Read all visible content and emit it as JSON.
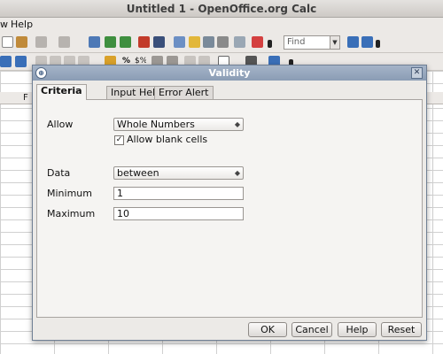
{
  "window": {
    "title": "Untitled 1 - OpenOffice.org Calc"
  },
  "menu": {
    "view_fragment": "w",
    "help": "Help"
  },
  "find": {
    "placeholder": "Find"
  },
  "columns": [
    "F"
  ],
  "dialog": {
    "title": "Validity",
    "tabs": [
      {
        "label": "Criteria",
        "active": true
      },
      {
        "label": "Input Help",
        "active": false
      },
      {
        "label": "Error Alert",
        "active": false
      }
    ],
    "allow": {
      "label": "Allow",
      "value": "Whole Numbers"
    },
    "allow_blank": {
      "label": "Allow blank cells",
      "checked": true
    },
    "data": {
      "label": "Data",
      "value": "between"
    },
    "minimum": {
      "label": "Minimum",
      "value": "1"
    },
    "maximum": {
      "label": "Maximum",
      "value": "10"
    },
    "buttons": {
      "ok": "OK",
      "cancel": "Cancel",
      "help": "Help",
      "reset": "Reset"
    }
  },
  "colors": {
    "title_bar": "#8a9cb4",
    "panel": "#f5f4f2",
    "toolbar": "#ece9e6"
  }
}
